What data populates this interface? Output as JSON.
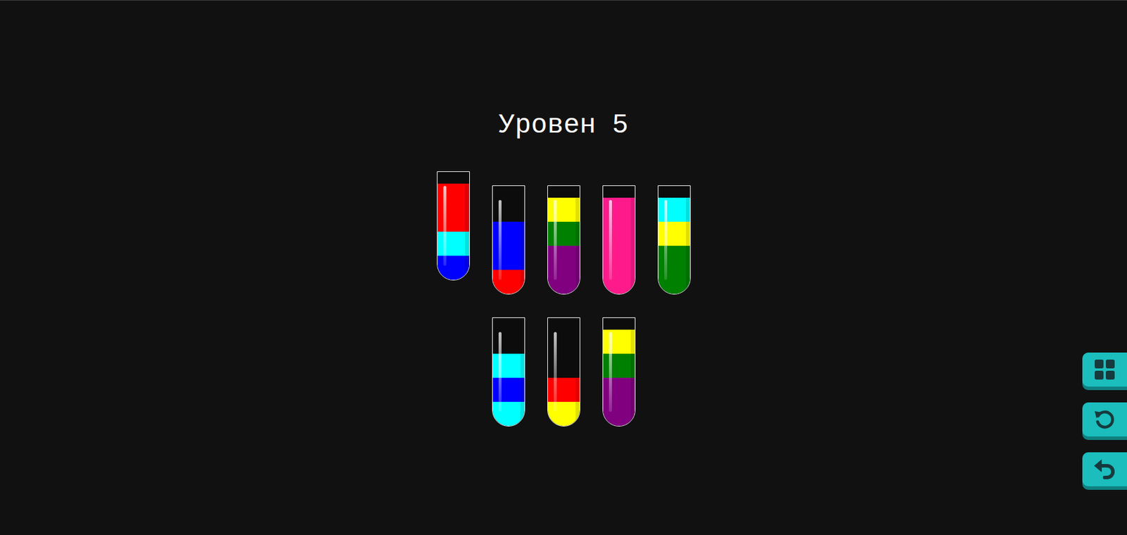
{
  "title": "Уровен 5",
  "rows": [
    {
      "tubes": [
        {
          "selected": true,
          "layers": [
            "#0000ff",
            "#00ffff",
            "#ff0000",
            "#ff0000"
          ]
        },
        {
          "selected": false,
          "layers": [
            "#ff0000",
            "#0000ff",
            "#0000ff"
          ]
        },
        {
          "selected": false,
          "layers": [
            "#800080",
            "#800080",
            "#008000",
            "#ffff00"
          ]
        },
        {
          "selected": false,
          "layers": [
            "#ff1a8c",
            "#ff1a8c",
            "#ff1a8c",
            "#ff1a8c"
          ]
        },
        {
          "selected": false,
          "layers": [
            "#008000",
            "#008000",
            "#ffff00",
            "#00ffff"
          ]
        }
      ]
    },
    {
      "tubes": [
        {
          "selected": false,
          "layers": [
            "#00ffff",
            "#0000ff",
            "#00ffff"
          ]
        },
        {
          "selected": false,
          "layers": [
            "#ffff00",
            "#ff0000"
          ]
        },
        {
          "selected": false,
          "layers": [
            "#800080",
            "#800080",
            "#008000",
            "#ffff00"
          ]
        }
      ]
    }
  ],
  "toolbar": [
    {
      "kind": "levels"
    },
    {
      "kind": "restart"
    },
    {
      "kind": "undo"
    }
  ]
}
